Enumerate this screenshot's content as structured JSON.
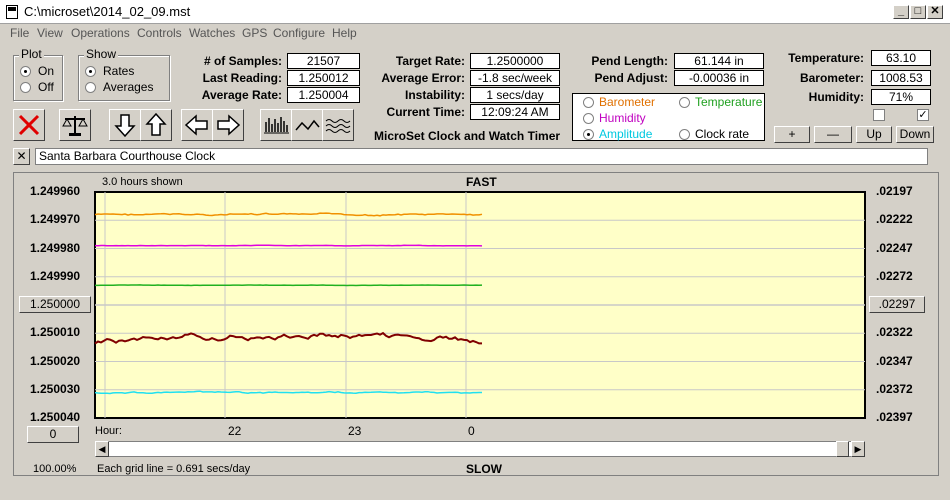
{
  "window": {
    "title": "C:\\microset\\2014_02_09.mst"
  },
  "menu": [
    "File",
    "View",
    "Operations",
    "Controls",
    "Watches",
    "GPS",
    "Configure",
    "Help"
  ],
  "plot": {
    "label": "Plot",
    "on": "On",
    "off": "Off",
    "selected": "On"
  },
  "show": {
    "label": "Show",
    "rates": "Rates",
    "averages": "Averages",
    "selected": "Rates"
  },
  "stats": {
    "samples_label": "# of Samples:",
    "samples": "21507",
    "last_label": "Last Reading:",
    "last": "1.250012",
    "avg_label": "Average Rate:",
    "avg": "1.250004",
    "target_label": "Target Rate:",
    "target": "1.2500000",
    "avgerr_label": "Average Error:",
    "avgerr": "-1.8 sec/week",
    "instab_label": "Instability:",
    "instab": "1 secs/day",
    "time_label": "Current Time:",
    "time": "12:09:24 AM",
    "pendlen_label": "Pend Length:",
    "pendlen": "61.144 in",
    "pendadj_label": "Pend Adjust:",
    "pendadj": "-0.00036 in",
    "temp_label": "Temperature:",
    "temp": "63.10",
    "baro_label": "Barometer:",
    "baro": "1008.53",
    "hum_label": "Humidity:",
    "hum": "71%"
  },
  "app_name": "MicroSet Clock and Watch Timer",
  "sensor_options": {
    "barometer": "Barometer",
    "temperature": "Temperature",
    "humidity": "Humidity",
    "amplitude": "Amplitude",
    "clockrate": "Clock rate",
    "selected": "Amplitude"
  },
  "adjust_buttons": {
    "plus": "+",
    "minus": "—",
    "up": "Up",
    "down": "Down"
  },
  "clock_name": "Santa Barbara Courthouse Clock",
  "close_x": "✕",
  "colors": {
    "plot_bg": "#ffffc8",
    "orange": "#f09000",
    "magenta": "#e000e0",
    "green": "#20b020",
    "darkred": "#800000",
    "cyan": "#20e0f0"
  },
  "chart_data": {
    "type": "line",
    "hours_shown": "3.0 hours shown",
    "top_label": "FAST",
    "bottom_label": "SLOW",
    "left_ticks": [
      "1.249960",
      "1.249970",
      "1.249980",
      "1.249990",
      "1.250000",
      "1.250010",
      "1.250020",
      "1.250030",
      "1.250040"
    ],
    "right_ticks": [
      ".02197",
      ".02222",
      ".02247",
      ".02272",
      ".02297",
      ".02322",
      ".02347",
      ".02372",
      ".02397"
    ],
    "left_center_button": "1.250000",
    "right_center_button": ".02297",
    "ylim": [
      1.24996,
      1.25004
    ],
    "x_label": "Hour:",
    "x_ticks": [
      "22",
      "23",
      "0"
    ],
    "bottom_button": "0",
    "zoom": "100.00%",
    "grid_note": "Each grid line = 0.691 secs/day",
    "series": [
      {
        "color": "#f09000",
        "level": 1.249968,
        "noise": 4e-07
      },
      {
        "color": "#e000e0",
        "level": 1.249979,
        "noise": 1e-07
      },
      {
        "color": "#20b020",
        "level": 1.249993,
        "noise": 1e-07
      },
      {
        "color": "#800000",
        "level": 1.250012,
        "noise": 1.1e-06
      },
      {
        "color": "#20e0f0",
        "level": 1.250031,
        "noise": 3e-07
      }
    ]
  }
}
